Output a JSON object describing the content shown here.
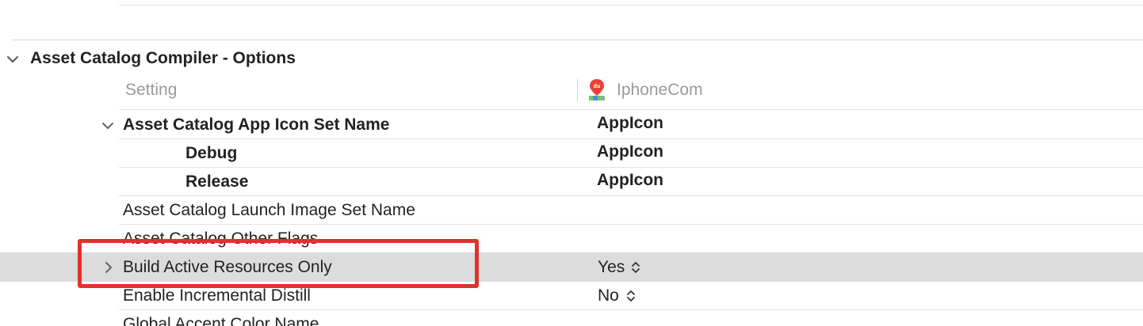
{
  "section": {
    "title": "Asset Catalog Compiler - Options"
  },
  "header": {
    "setting_label": "Setting",
    "target_name": "IphoneCom",
    "target_icon": "map-pin-app-icon",
    "target_icon_label": "du"
  },
  "rows": [
    {
      "label": "Asset Catalog App Icon Set Name",
      "value": "AppIcon",
      "expanded": true
    },
    {
      "label": "Debug",
      "value": "AppIcon"
    },
    {
      "label": "Release",
      "value": "AppIcon"
    },
    {
      "label": "Asset Catalog Launch Image Set Name",
      "value": ""
    },
    {
      "label": "Asset Catalog Other Flags",
      "value": ""
    },
    {
      "label": "Build Active Resources Only",
      "value": "Yes",
      "selected": true
    },
    {
      "label": "Enable Incremental Distill",
      "value": "No"
    },
    {
      "label": "Global Accent Color Name",
      "value": ""
    }
  ],
  "colors": {
    "selection": "#dcdcdc",
    "annotation_box": "#e0322d",
    "header_text": "#9a9a9a"
  }
}
